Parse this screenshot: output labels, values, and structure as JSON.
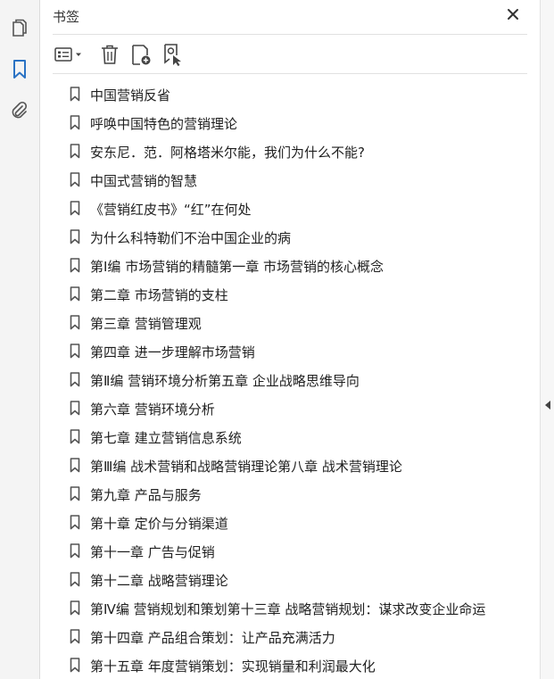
{
  "panel": {
    "title": "书签"
  },
  "bookmarks": [
    {
      "label": "中国营销反省"
    },
    {
      "label": "呼唤中国特色的营销理论"
    },
    {
      "label": "安东尼．范．阿格塔米尔能，我们为什么不能?"
    },
    {
      "label": "中国式营销的智慧"
    },
    {
      "label": "《营销红皮书》“红”在何处"
    },
    {
      "label": "为什么科特勒们不治中国企业的病"
    },
    {
      "label": "第Ⅰ编  市场营销的精髓第一章  市场营销的核心概念"
    },
    {
      "label": "第二章  市场营销的支柱"
    },
    {
      "label": "第三章  营销管理观"
    },
    {
      "label": "第四章  进一步理解市场营销"
    },
    {
      "label": "第Ⅱ编  营销环境分析第五章  企业战略思维导向"
    },
    {
      "label": "第六章  营销环境分析"
    },
    {
      "label": "第七章  建立营销信息系统"
    },
    {
      "label": "第Ⅲ编  战术营销和战略营销理论第八章  战术营销理论"
    },
    {
      "label": "第九章  产品与服务"
    },
    {
      "label": "第十章  定价与分销渠道"
    },
    {
      "label": "第十一章  广告与促销"
    },
    {
      "label": "第十二章  战略营销理论"
    },
    {
      "label": "第Ⅳ编  营销规划和策划第十三章  战略营销规划：谋求改变企业命运"
    },
    {
      "label": "第十四章  产品组合策划：让产品充满活力"
    },
    {
      "label": "第十五章  年度营销策划：实现销量和利润最大化"
    }
  ]
}
